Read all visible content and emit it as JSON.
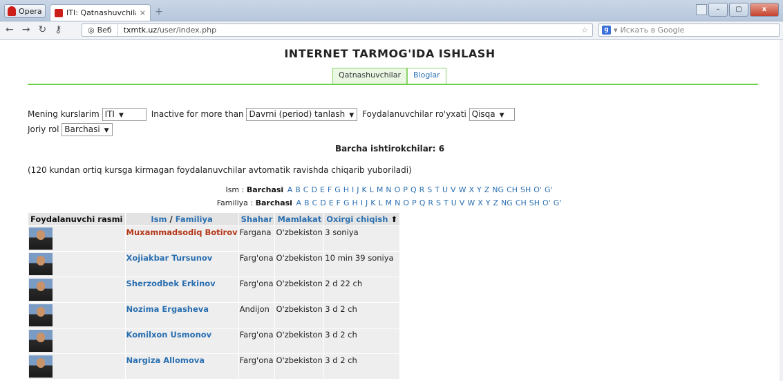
{
  "browser": {
    "opera_label": "Opera",
    "tab_title": "ITI: Qatnashuvchilar",
    "tab_close": "×",
    "newtab": "+",
    "veb": "Веб",
    "url_host": "txmtk.uz",
    "url_path": "/user/index.php",
    "search_placeholder": "Искать в Google",
    "win_minimize": "–",
    "win_maximize": "▢",
    "win_close": "x"
  },
  "page": {
    "heading": "INTERNET TARMOG'IDA ISHLASH",
    "tabs": [
      {
        "label": "Qatnashuvchilar",
        "active": true
      },
      {
        "label": "Bloglar",
        "active": false
      }
    ],
    "filters": {
      "my_courses_label": "Mening kurslarim",
      "my_courses_value": "ITI",
      "inactive_label": "Inactive for more than",
      "inactive_value": "Davrni (period) tanlash",
      "list_label": "Foydalanuvchilar ro'yxati",
      "list_value": "Qisqa",
      "role_label": "Joriy rol",
      "role_value": "Barchasi"
    },
    "total": "Barcha ishtirokchilar: 6",
    "note": "(120 kundan ortiq kursga kirmagan foydalanuvchilar avtomatik ravishda chiqarib yuboriladi)",
    "alpha_first_label": "Ism :",
    "alpha_last_label": "Familiya :",
    "alpha_all": "Barchasi",
    "letters": [
      "A",
      "B",
      "C",
      "D",
      "E",
      "F",
      "G",
      "H",
      "I",
      "J",
      "K",
      "L",
      "M",
      "N",
      "O",
      "P",
      "Q",
      "R",
      "S",
      "T",
      "U",
      "V",
      "W",
      "X",
      "Y",
      "Z",
      "NG",
      "CH",
      "SH",
      "O'",
      "G'"
    ]
  },
  "table": {
    "headers": {
      "photo": "Foydalanuvchi rasmi",
      "first": "Ism",
      "sep": " / ",
      "last": "Familiya",
      "city": "Shahar",
      "country": "Mamlakat",
      "lastaccess": "Oxirgi chiqish",
      "sort_icon": "⬆"
    },
    "rows": [
      {
        "name": "Muxammadsodiq Botirov",
        "city": "Fargana",
        "country": "O'zbekiston",
        "last": "3 soniya",
        "highlight": true
      },
      {
        "name": "Xojiakbar Tursunov",
        "city": "Farg'ona",
        "country": "O'zbekiston",
        "last": "10 min 39 soniya"
      },
      {
        "name": "Sherzodbek Erkinov",
        "city": "Farg'ona",
        "country": "O'zbekiston",
        "last": "2 d 22 ch"
      },
      {
        "name": "Nozima Ergasheva",
        "city": "Andijon",
        "country": "O'zbekiston",
        "last": "3 d 2 ch"
      },
      {
        "name": "Komilxon Usmonov",
        "city": "Farg'ona",
        "country": "O'zbekiston",
        "last": "3 d 2 ch"
      },
      {
        "name": "Nargiza Allomova",
        "city": "Farg'ona",
        "country": "O'zbekiston",
        "last": "3 d 2 ch"
      }
    ]
  }
}
